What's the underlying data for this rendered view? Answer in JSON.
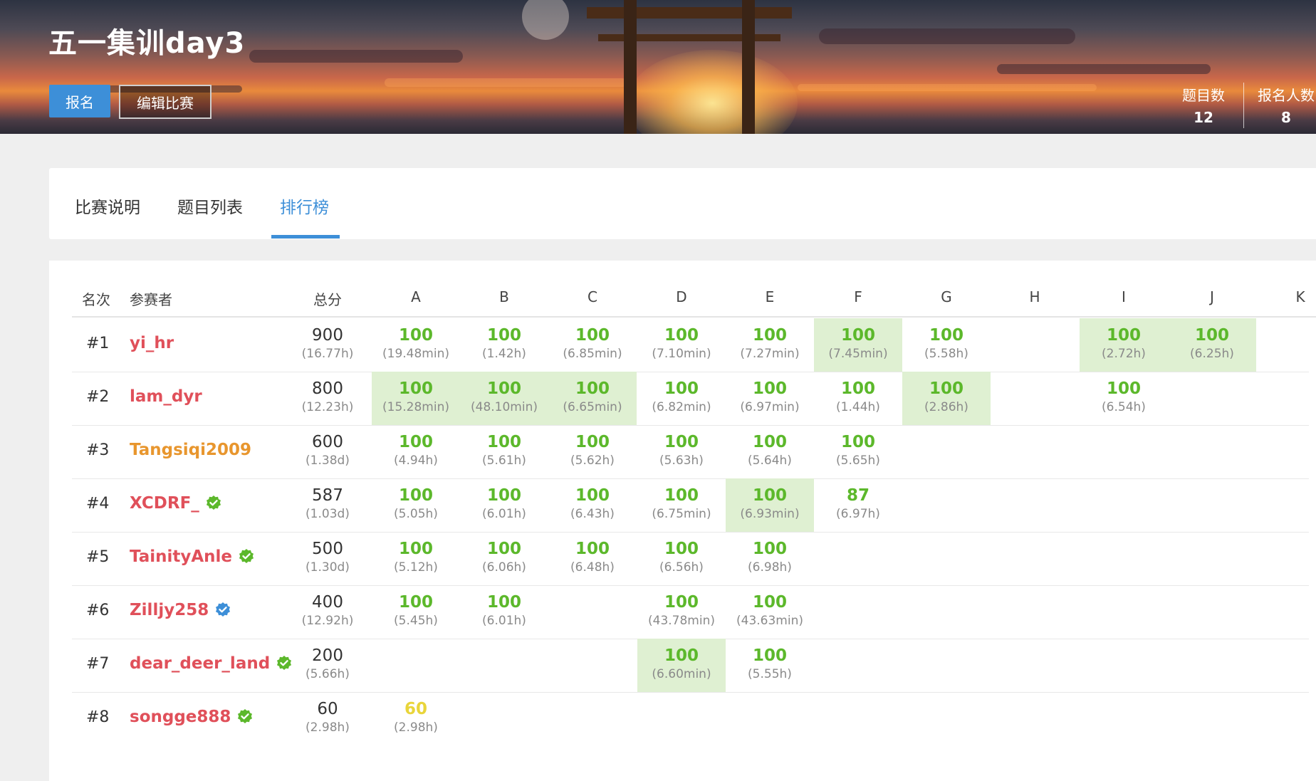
{
  "contest": {
    "title": "五一集训day3",
    "signup_label": "报名",
    "edit_label": "编辑比赛",
    "stats": [
      {
        "label": "题目数",
        "value": "12"
      },
      {
        "label": "报名人数",
        "value": "8"
      }
    ]
  },
  "tabs": [
    {
      "label": "比赛说明",
      "active": false
    },
    {
      "label": "题目列表",
      "active": false
    },
    {
      "label": "排行榜",
      "active": true
    }
  ],
  "ranking": {
    "headers": {
      "rank": "名次",
      "user": "参赛者",
      "total": "总分"
    },
    "problems": [
      "A",
      "B",
      "C",
      "D",
      "E",
      "F",
      "G",
      "H",
      "I",
      "J",
      "K"
    ],
    "rows": [
      {
        "rank": "#1",
        "user": "yi_hr",
        "color": "red",
        "badge": "none",
        "score": "900",
        "time": "(16.77h)",
        "cells": [
          {
            "s": "100",
            "t": "(19.48min)",
            "fb": false
          },
          {
            "s": "100",
            "t": "(1.42h)",
            "fb": false
          },
          {
            "s": "100",
            "t": "(6.85min)",
            "fb": false
          },
          {
            "s": "100",
            "t": "(7.10min)",
            "fb": false
          },
          {
            "s": "100",
            "t": "(7.27min)",
            "fb": false
          },
          {
            "s": "100",
            "t": "(7.45min)",
            "fb": true
          },
          {
            "s": "100",
            "t": "(5.58h)",
            "fb": false
          },
          null,
          {
            "s": "100",
            "t": "(2.72h)",
            "fb": true
          },
          {
            "s": "100",
            "t": "(6.25h)",
            "fb": true
          },
          null
        ]
      },
      {
        "rank": "#2",
        "user": "lam_dyr",
        "color": "red",
        "badge": "none",
        "score": "800",
        "time": "(12.23h)",
        "cells": [
          {
            "s": "100",
            "t": "(15.28min)",
            "fb": true
          },
          {
            "s": "100",
            "t": "(48.10min)",
            "fb": true
          },
          {
            "s": "100",
            "t": "(6.65min)",
            "fb": true
          },
          {
            "s": "100",
            "t": "(6.82min)",
            "fb": false
          },
          {
            "s": "100",
            "t": "(6.97min)",
            "fb": false
          },
          {
            "s": "100",
            "t": "(1.44h)",
            "fb": false
          },
          {
            "s": "100",
            "t": "(2.86h)",
            "fb": true
          },
          null,
          {
            "s": "100",
            "t": "(6.54h)",
            "fb": false
          },
          null,
          null
        ]
      },
      {
        "rank": "#3",
        "user": "Tangsiqi2009",
        "color": "orange",
        "badge": "none",
        "score": "600",
        "time": "(1.38d)",
        "cells": [
          {
            "s": "100",
            "t": "(4.94h)",
            "fb": false
          },
          {
            "s": "100",
            "t": "(5.61h)",
            "fb": false
          },
          {
            "s": "100",
            "t": "(5.62h)",
            "fb": false
          },
          {
            "s": "100",
            "t": "(5.63h)",
            "fb": false
          },
          {
            "s": "100",
            "t": "(5.64h)",
            "fb": false
          },
          {
            "s": "100",
            "t": "(5.65h)",
            "fb": false
          },
          null,
          null,
          null,
          null,
          null
        ]
      },
      {
        "rank": "#4",
        "user": "XCDRF_",
        "color": "red",
        "badge": "green",
        "score": "587",
        "time": "(1.03d)",
        "cells": [
          {
            "s": "100",
            "t": "(5.05h)",
            "fb": false
          },
          {
            "s": "100",
            "t": "(6.01h)",
            "fb": false
          },
          {
            "s": "100",
            "t": "(6.43h)",
            "fb": false
          },
          {
            "s": "100",
            "t": "(6.75min)",
            "fb": false
          },
          {
            "s": "100",
            "t": "(6.93min)",
            "fb": true
          },
          {
            "s": "87",
            "t": "(6.97h)",
            "fb": false
          },
          null,
          null,
          null,
          null,
          null
        ]
      },
      {
        "rank": "#5",
        "user": "TainityAnle",
        "color": "red",
        "badge": "green",
        "score": "500",
        "time": "(1.30d)",
        "cells": [
          {
            "s": "100",
            "t": "(5.12h)",
            "fb": false
          },
          {
            "s": "100",
            "t": "(6.06h)",
            "fb": false
          },
          {
            "s": "100",
            "t": "(6.48h)",
            "fb": false
          },
          {
            "s": "100",
            "t": "(6.56h)",
            "fb": false
          },
          {
            "s": "100",
            "t": "(6.98h)",
            "fb": false
          },
          null,
          null,
          null,
          null,
          null,
          null
        ]
      },
      {
        "rank": "#6",
        "user": "Zilljy258",
        "color": "red",
        "badge": "blue",
        "score": "400",
        "time": "(12.92h)",
        "cells": [
          {
            "s": "100",
            "t": "(5.45h)",
            "fb": false
          },
          {
            "s": "100",
            "t": "(6.01h)",
            "fb": false
          },
          null,
          {
            "s": "100",
            "t": "(43.78min)",
            "fb": false
          },
          {
            "s": "100",
            "t": "(43.63min)",
            "fb": false
          },
          null,
          null,
          null,
          null,
          null,
          null
        ]
      },
      {
        "rank": "#7",
        "user": "dear_deer_land",
        "color": "red",
        "badge": "green",
        "score": "200",
        "time": "(5.66h)",
        "cells": [
          null,
          null,
          null,
          {
            "s": "100",
            "t": "(6.60min)",
            "fb": true
          },
          {
            "s": "100",
            "t": "(5.55h)",
            "fb": false
          },
          null,
          null,
          null,
          null,
          null,
          null
        ]
      },
      {
        "rank": "#8",
        "user": "songge888",
        "color": "red",
        "badge": "green",
        "score": "60",
        "time": "(2.98h)",
        "cells": [
          {
            "s": "60",
            "t": "(2.98h)",
            "fb": false,
            "partial": true
          },
          null,
          null,
          null,
          null,
          null,
          null,
          null,
          null,
          null,
          null
        ]
      }
    ]
  },
  "colors": {
    "accent": "#3d8fd8",
    "accepted": "#5cb82b",
    "partial": "#e9d53a",
    "first_blood_bg": "#dff0d2",
    "user_red": "#e0505a",
    "user_orange": "#e8962e"
  }
}
